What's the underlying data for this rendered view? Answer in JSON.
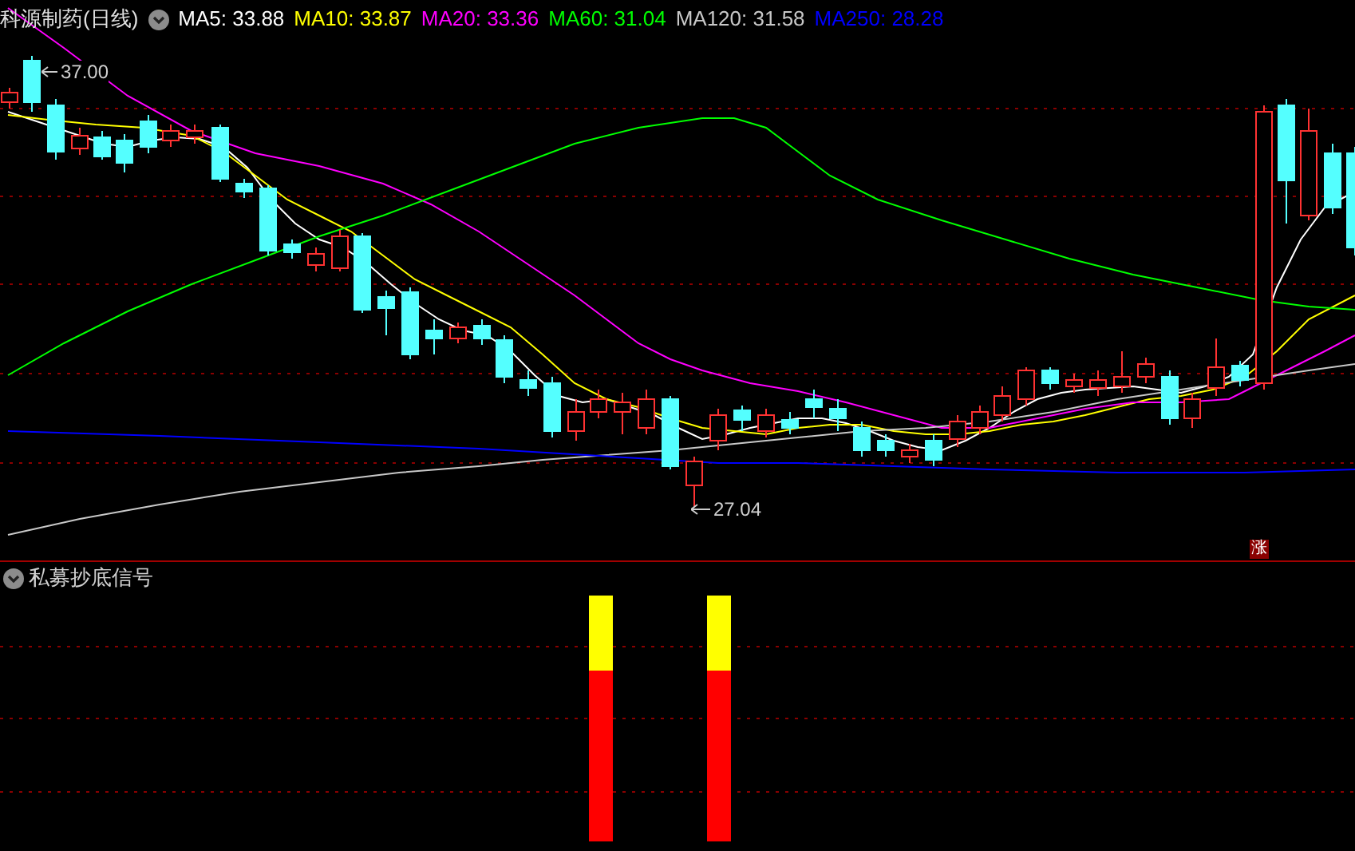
{
  "main_panel": {
    "title": "科源制药(日线)",
    "legend": [
      {
        "label": "MA5: 33.88",
        "color": "#ffffff"
      },
      {
        "label": "MA10: 33.87",
        "color": "#ffff00"
      },
      {
        "label": "MA20: 33.36",
        "color": "#ff00ff"
      },
      {
        "label": "MA60: 31.04",
        "color": "#00ff00"
      },
      {
        "label": "MA120: 31.58",
        "color": "#c8c8c8"
      },
      {
        "label": "MA250: 28.28",
        "color": "#0000ff"
      }
    ],
    "high_label": "37.00",
    "low_label": "27.04",
    "badge": "涨"
  },
  "indicator_panel": {
    "title": "私募抄底信号"
  }
}
